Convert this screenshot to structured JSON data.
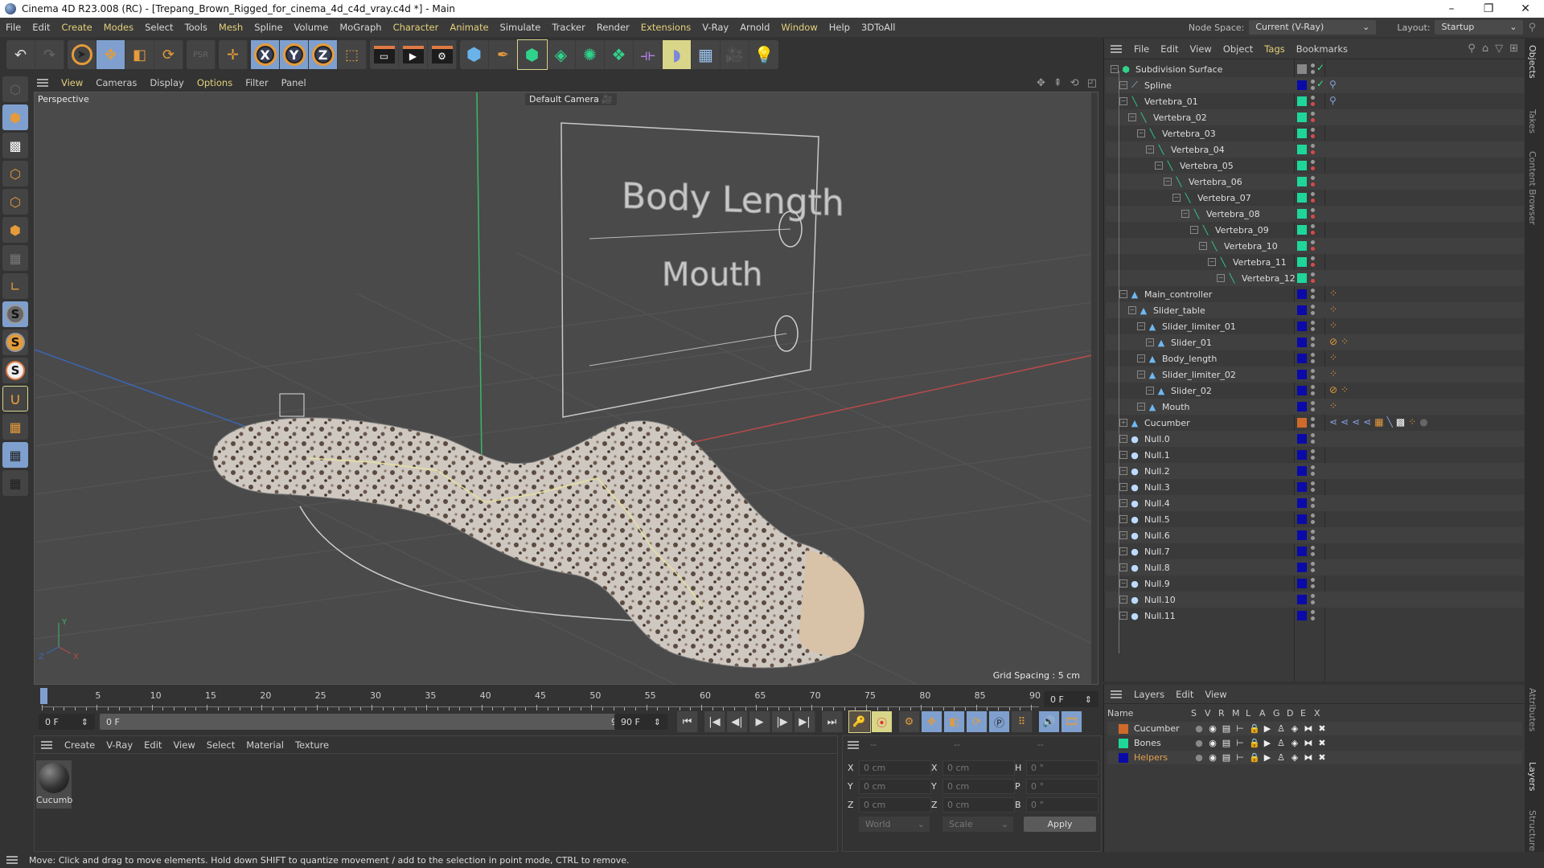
{
  "window": {
    "title": "Cinema 4D R23.008 (RC) - [Trepang_Brown_Rigged_for_cinema_4d_c4d_vray.c4d *] - Main",
    "controls": [
      "–",
      "❐",
      "✕"
    ]
  },
  "menubar": {
    "items": [
      {
        "label": "File",
        "hl": false
      },
      {
        "label": "Edit",
        "hl": false
      },
      {
        "label": "Create",
        "hl": true
      },
      {
        "label": "Modes",
        "hl": true
      },
      {
        "label": "Select",
        "hl": false
      },
      {
        "label": "Tools",
        "hl": false
      },
      {
        "label": "Mesh",
        "hl": true
      },
      {
        "label": "Spline",
        "hl": false
      },
      {
        "label": "Volume",
        "hl": false
      },
      {
        "label": "MoGraph",
        "hl": false
      },
      {
        "label": "Character",
        "hl": true
      },
      {
        "label": "Animate",
        "hl": true
      },
      {
        "label": "Simulate",
        "hl": false
      },
      {
        "label": "Tracker",
        "hl": false
      },
      {
        "label": "Render",
        "hl": false
      },
      {
        "label": "Extensions",
        "hl": true
      },
      {
        "label": "V-Ray",
        "hl": false
      },
      {
        "label": "Arnold",
        "hl": false
      },
      {
        "label": "Window",
        "hl": true
      },
      {
        "label": "Help",
        "hl": false
      },
      {
        "label": "3DToAll",
        "hl": false
      }
    ],
    "node_space_label": "Node Space:",
    "node_space_value": "Current (V-Ray)",
    "layout_label": "Layout:",
    "layout_value": "Startup"
  },
  "toolbar": {
    "groups": [
      [
        "undo-icon",
        "redo-icon"
      ],
      [
        "select-icon",
        "move-icon",
        "scale-icon",
        "rotate-icon"
      ],
      [
        "psr-icon"
      ],
      [
        "live-select-icon"
      ],
      [
        "x-axis-icon",
        "y-axis-icon",
        "z-axis-icon",
        "coordinate-system-icon"
      ],
      [
        "render-view-icon",
        "render-picture-viewer-icon",
        "render-settings-icon"
      ],
      [
        "cube-icon",
        "pen-icon",
        "subdivision-icon",
        "extrude-icon",
        "mograph-cloner-icon",
        "array-icon",
        "deformer-icon",
        "bend-icon",
        "floor-icon",
        "camera-icon",
        "light-icon"
      ]
    ]
  },
  "left_palette": [
    "make-editable-icon",
    "model-mode-icon",
    "texture-mode-icon",
    "point-mode-icon",
    "edge-mode-icon",
    "polygon-mode-icon",
    "uv-mode-icon",
    "axis-icon",
    "solo-icon",
    "solo-hierarchy-icon",
    "solo-off-icon",
    "snap-icon",
    "workplane-icon",
    "locked-workplane-icon",
    "workplane-sync-icon"
  ],
  "viewport": {
    "menu": [
      {
        "label": "View",
        "hl": true
      },
      {
        "label": "Cameras",
        "hl": false
      },
      {
        "label": "Display",
        "hl": false
      },
      {
        "label": "Options",
        "hl": true
      },
      {
        "label": "Filter",
        "hl": false
      },
      {
        "label": "Panel",
        "hl": false
      }
    ],
    "view_name": "Perspective",
    "camera": "Default Camera",
    "grid_spacing": "Grid Spacing : 5 cm",
    "panel_text": {
      "top": "Body Length",
      "bottom": "Mouth"
    },
    "axis_labels": {
      "y": "Y",
      "z": "Z",
      "x": "X"
    }
  },
  "timeline": {
    "ticks": [
      "0",
      "5",
      "10",
      "15",
      "20",
      "25",
      "30",
      "35",
      "40",
      "45",
      "50",
      "55",
      "60",
      "65",
      "70",
      "75",
      "80",
      "85",
      "90"
    ],
    "current_frame": "0 F",
    "start_frame": "0 F",
    "range_start": "0 F",
    "range_end": "90 F",
    "end_frame": "90 F",
    "current_frame_right": "0 F",
    "playhead_frame": 0,
    "max_frame": 90
  },
  "material_manager": {
    "menu": [
      "Create",
      "V-Ray",
      "Edit",
      "View",
      "Select",
      "Material",
      "Texture"
    ],
    "materials": [
      {
        "name": "Cucumb"
      }
    ]
  },
  "coordinates": {
    "header": [
      "--",
      "--",
      "--"
    ],
    "position": [
      {
        "axis": "X",
        "value": "0 cm"
      },
      {
        "axis": "Y",
        "value": "0 cm"
      },
      {
        "axis": "Z",
        "value": "0 cm"
      }
    ],
    "size": [
      {
        "axis": "X",
        "value": "0 cm"
      },
      {
        "axis": "Y",
        "value": "0 cm"
      },
      {
        "axis": "Z",
        "value": "0 cm"
      }
    ],
    "rotation": [
      {
        "axis": "H",
        "value": "0 °"
      },
      {
        "axis": "P",
        "value": "0 °"
      },
      {
        "axis": "B",
        "value": "0 °"
      }
    ],
    "space": "World",
    "mode": "Scale",
    "apply_label": "Apply"
  },
  "status": {
    "text": "Move: Click and drag to move elements. Hold down SHIFT to quantize movement / add to the selection in point mode, CTRL to remove."
  },
  "object_manager": {
    "menu": [
      {
        "label": "File",
        "hl": false
      },
      {
        "label": "Edit",
        "hl": false
      },
      {
        "label": "View",
        "hl": false
      },
      {
        "label": "Object",
        "hl": false
      },
      {
        "label": "Tags",
        "hl": true
      },
      {
        "label": "Bookmarks",
        "hl": false
      }
    ],
    "objects": [
      {
        "name": "Subdivision Surface",
        "depth": 0,
        "type": "subdivision",
        "color": "#888888",
        "check": true,
        "red": false,
        "tags": ""
      },
      {
        "name": "Spline",
        "depth": 1,
        "type": "spline",
        "color": "#0a0aa8",
        "check": true,
        "red": false,
        "tags": "ik"
      },
      {
        "name": "Vertebra_01",
        "depth": 1,
        "type": "bone",
        "color": "#1fd69a",
        "check": false,
        "red": true,
        "tags": "ik"
      },
      {
        "name": "Vertebra_02",
        "depth": 2,
        "type": "bone",
        "color": "#1fd69a",
        "check": false,
        "red": true,
        "tags": ""
      },
      {
        "name": "Vertebra_03",
        "depth": 3,
        "type": "bone",
        "color": "#1fd69a",
        "check": false,
        "red": true,
        "tags": ""
      },
      {
        "name": "Vertebra_04",
        "depth": 4,
        "type": "bone",
        "color": "#1fd69a",
        "check": false,
        "red": true,
        "tags": ""
      },
      {
        "name": "Vertebra_05",
        "depth": 5,
        "type": "bone",
        "color": "#1fd69a",
        "check": false,
        "red": true,
        "tags": ""
      },
      {
        "name": "Vertebra_06",
        "depth": 6,
        "type": "bone",
        "color": "#1fd69a",
        "check": false,
        "red": true,
        "tags": ""
      },
      {
        "name": "Vertebra_07",
        "depth": 7,
        "type": "bone",
        "color": "#1fd69a",
        "check": false,
        "red": true,
        "tags": ""
      },
      {
        "name": "Vertebra_08",
        "depth": 8,
        "type": "bone",
        "color": "#1fd69a",
        "check": false,
        "red": true,
        "tags": ""
      },
      {
        "name": "Vertebra_09",
        "depth": 9,
        "type": "bone",
        "color": "#1fd69a",
        "check": false,
        "red": true,
        "tags": ""
      },
      {
        "name": "Vertebra_10",
        "depth": 10,
        "type": "bone",
        "color": "#1fd69a",
        "check": false,
        "red": true,
        "tags": ""
      },
      {
        "name": "Vertebra_11",
        "depth": 11,
        "type": "bone",
        "color": "#1fd69a",
        "check": false,
        "red": true,
        "tags": ""
      },
      {
        "name": "Vertebra_12",
        "depth": 12,
        "type": "bone",
        "color": "#1fd69a",
        "check": false,
        "red": true,
        "tags": ""
      },
      {
        "name": "Main_controller",
        "depth": 1,
        "type": "joint",
        "color": "#0a0aa8",
        "check": false,
        "red": false,
        "tags": "xpresso"
      },
      {
        "name": "Slider_table",
        "depth": 2,
        "type": "joint",
        "color": "#0a0aa8",
        "check": false,
        "red": false,
        "tags": "xpresso"
      },
      {
        "name": "Slider_limiter_01",
        "depth": 3,
        "type": "joint",
        "color": "#0a0aa8",
        "check": false,
        "red": false,
        "tags": "xpresso"
      },
      {
        "name": "Slider_01",
        "depth": 4,
        "type": "joint",
        "color": "#0a0aa8",
        "check": false,
        "red": false,
        "tags": "protect xpresso"
      },
      {
        "name": "Body_length",
        "depth": 3,
        "type": "joint",
        "color": "#0a0aa8",
        "check": false,
        "red": false,
        "tags": "xpresso"
      },
      {
        "name": "Slider_limiter_02",
        "depth": 3,
        "type": "joint",
        "color": "#0a0aa8",
        "check": false,
        "red": false,
        "tags": "xpresso"
      },
      {
        "name": "Slider_02",
        "depth": 4,
        "type": "joint",
        "color": "#0a0aa8",
        "check": false,
        "red": false,
        "tags": "protect xpresso"
      },
      {
        "name": "Mouth",
        "depth": 3,
        "type": "joint",
        "color": "#0a0aa8",
        "check": false,
        "red": false,
        "tags": "xpresso"
      },
      {
        "name": "Cucumber",
        "depth": 1,
        "type": "joint",
        "color": "#d06a2a",
        "check": false,
        "red": false,
        "tags": "cucumber"
      },
      {
        "name": "Null.0",
        "depth": 1,
        "type": "null",
        "color": "#0a0aa8",
        "check": false,
        "red": false,
        "tags": ""
      },
      {
        "name": "Null.1",
        "depth": 1,
        "type": "null",
        "color": "#0a0aa8",
        "check": false,
        "red": false,
        "tags": ""
      },
      {
        "name": "Null.2",
        "depth": 1,
        "type": "null",
        "color": "#0a0aa8",
        "check": false,
        "red": false,
        "tags": ""
      },
      {
        "name": "Null.3",
        "depth": 1,
        "type": "null",
        "color": "#0a0aa8",
        "check": false,
        "red": false,
        "tags": ""
      },
      {
        "name": "Null.4",
        "depth": 1,
        "type": "null",
        "color": "#0a0aa8",
        "check": false,
        "red": false,
        "tags": ""
      },
      {
        "name": "Null.5",
        "depth": 1,
        "type": "null",
        "color": "#0a0aa8",
        "check": false,
        "red": false,
        "tags": ""
      },
      {
        "name": "Null.6",
        "depth": 1,
        "type": "null",
        "color": "#0a0aa8",
        "check": false,
        "red": false,
        "tags": ""
      },
      {
        "name": "Null.7",
        "depth": 1,
        "type": "null",
        "color": "#0a0aa8",
        "check": false,
        "red": false,
        "tags": ""
      },
      {
        "name": "Null.8",
        "depth": 1,
        "type": "null",
        "color": "#0a0aa8",
        "check": false,
        "red": false,
        "tags": ""
      },
      {
        "name": "Null.9",
        "depth": 1,
        "type": "null",
        "color": "#0a0aa8",
        "check": false,
        "red": false,
        "tags": ""
      },
      {
        "name": "Null.10",
        "depth": 1,
        "type": "null",
        "color": "#0a0aa8",
        "check": false,
        "red": false,
        "tags": ""
      },
      {
        "name": "Null.11",
        "depth": 1,
        "type": "null",
        "color": "#0a0aa8",
        "check": false,
        "red": false,
        "tags": ""
      }
    ]
  },
  "right_tabs": [
    {
      "label": "Objects",
      "active": true
    },
    {
      "label": "Takes",
      "active": false
    },
    {
      "label": "Content Browser",
      "active": false
    },
    {
      "label": "Attributes",
      "active": false
    },
    {
      "label": "Layers",
      "active": true
    },
    {
      "label": "Structure",
      "active": false
    }
  ],
  "layers": {
    "menu": [
      "Layers",
      "Edit",
      "View"
    ],
    "columns": [
      "Name",
      "S",
      "V",
      "R",
      "M",
      "L",
      "A",
      "G",
      "D",
      "E",
      "X"
    ],
    "rows": [
      {
        "name": "Cucumber",
        "color": "#d06a2a",
        "highlight": false
      },
      {
        "name": "Bones",
        "color": "#1fd69a",
        "highlight": false
      },
      {
        "name": "Helpers",
        "color": "#0a0aa8",
        "highlight": true
      }
    ]
  }
}
